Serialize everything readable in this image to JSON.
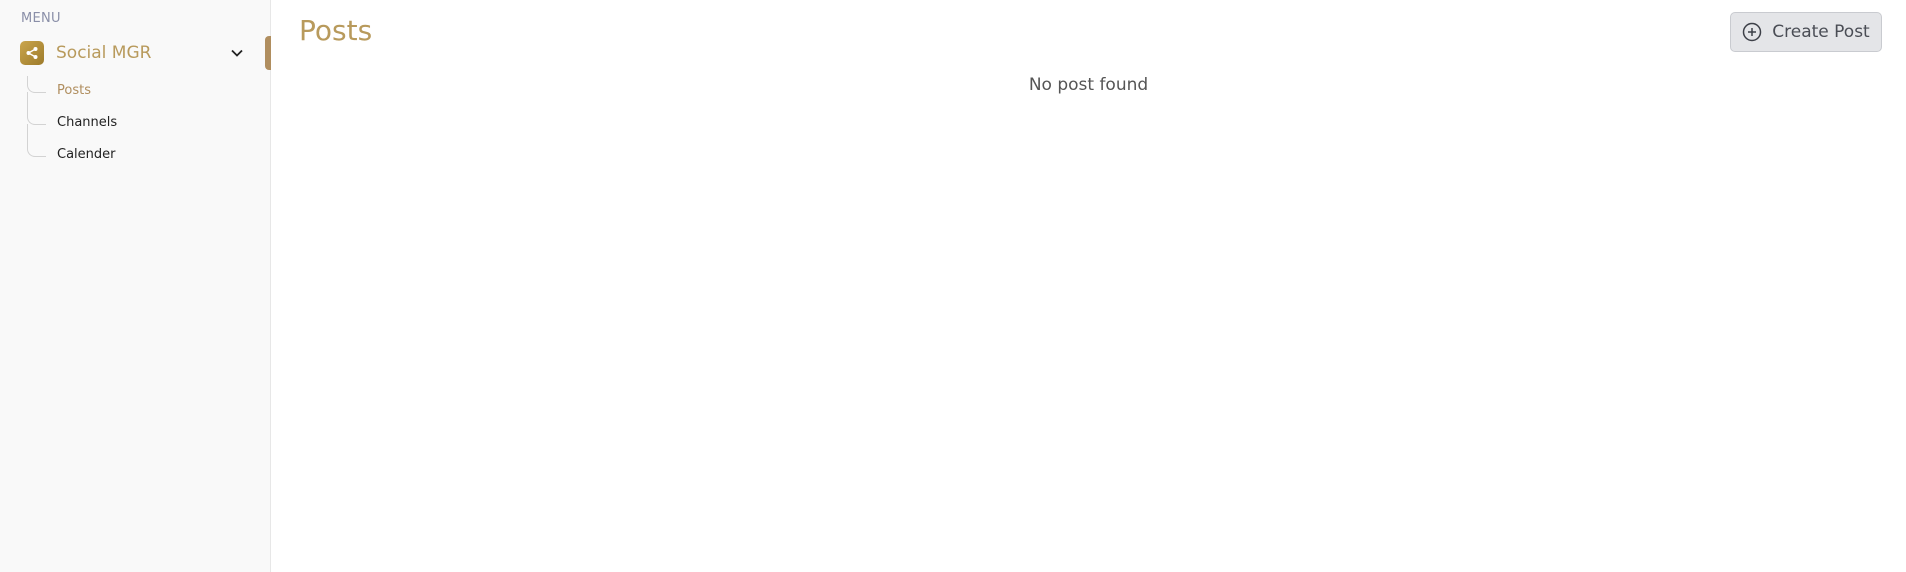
{
  "sidebar": {
    "menu_label": "MENU",
    "group": {
      "title": "Social MGR",
      "icon": "share-icon",
      "expanded": true
    },
    "items": [
      {
        "label": "Posts",
        "active": true
      },
      {
        "label": "Channels",
        "active": false
      },
      {
        "label": "Calender",
        "active": false
      }
    ]
  },
  "main": {
    "title": "Posts",
    "create_button_label": "Create Post",
    "create_button_icon": "plus-circle-icon",
    "empty_message": "No post found"
  },
  "colors": {
    "accent": "#b08e5f",
    "title": "#b89a5c",
    "icon_gradient_start": "#caa54c",
    "icon_gradient_end": "#9d7b2b"
  }
}
